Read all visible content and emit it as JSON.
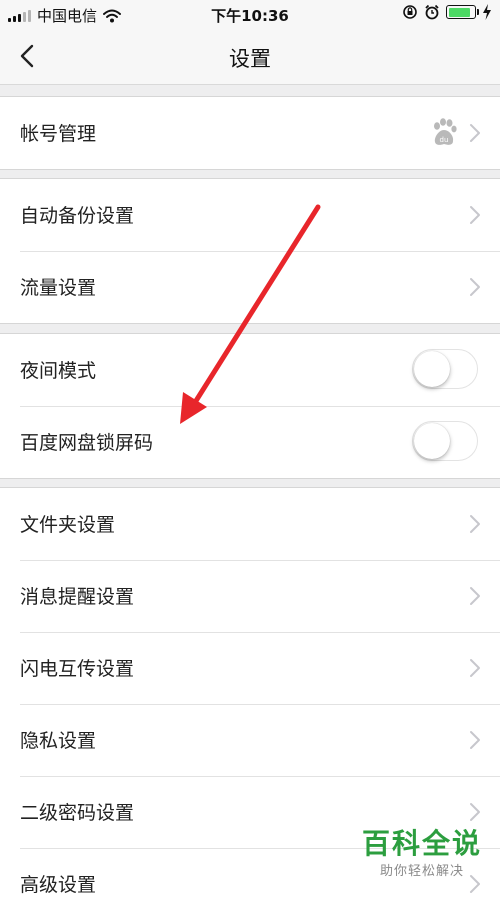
{
  "status_bar": {
    "carrier": "中国电信",
    "time": "下午10:36",
    "icons": [
      "signal-icon",
      "wifi-icon",
      "orientation-lock-icon",
      "alarm-icon",
      "battery-icon",
      "charging-icon"
    ]
  },
  "nav": {
    "title": "设置",
    "back_icon": "chevron-left-icon"
  },
  "groups": [
    {
      "items": [
        {
          "label": "帐号管理",
          "control": "chevron",
          "extra_icon": "baidu-paw-icon"
        }
      ]
    },
    {
      "items": [
        {
          "label": "自动备份设置",
          "control": "chevron"
        },
        {
          "label": "流量设置",
          "control": "chevron"
        }
      ]
    },
    {
      "items": [
        {
          "label": "夜间模式",
          "control": "toggle",
          "on": false
        },
        {
          "label": "百度网盘锁屏码",
          "control": "toggle",
          "on": false
        }
      ]
    },
    {
      "items": [
        {
          "label": "文件夹设置",
          "control": "chevron"
        },
        {
          "label": "消息提醒设置",
          "control": "chevron"
        },
        {
          "label": "闪电互传设置",
          "control": "chevron"
        },
        {
          "label": "隐私设置",
          "control": "chevron"
        },
        {
          "label": "二级密码设置",
          "control": "chevron"
        },
        {
          "label": "高级设置",
          "control": "chevron"
        }
      ]
    }
  ],
  "annotation": {
    "arrow_color": "#e8262b"
  },
  "watermark": {
    "title": "百科全说",
    "subtitle": "助你轻松解决",
    "color": "#2c9e3f"
  },
  "colors": {
    "toggle_off_track": "#ffffff",
    "battery_fill": "#4cd964",
    "chevron": "#c7c7cc"
  }
}
